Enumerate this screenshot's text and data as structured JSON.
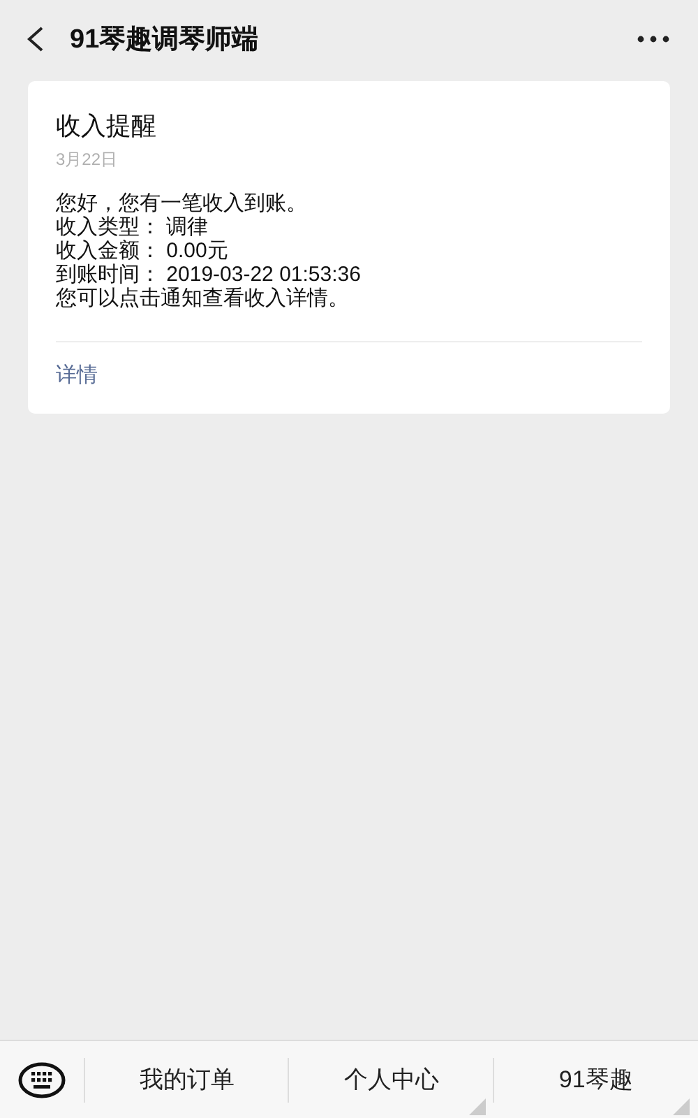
{
  "header": {
    "title": "91琴趣调琴师端"
  },
  "card": {
    "title": "收入提醒",
    "date": "3月22日",
    "lines": [
      "您好，您有一笔收入到账。",
      "收入类型： 调律",
      "收入金额： 0.00元",
      "到账时间： 2019-03-22 01:53:36",
      "您可以点击通知查看收入详情。"
    ],
    "link": "详情"
  },
  "menu": [
    {
      "label": "我的订单",
      "has_submenu": false
    },
    {
      "label": "个人中心",
      "has_submenu": true
    },
    {
      "label": "91琴趣",
      "has_submenu": true
    }
  ]
}
